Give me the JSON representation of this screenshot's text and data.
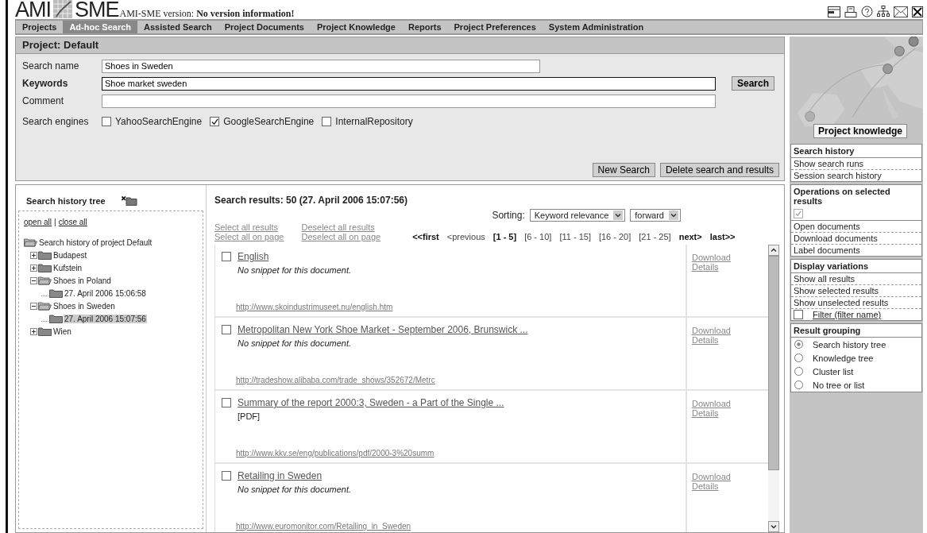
{
  "header": {
    "logo_left": "AMI",
    "logo_right": "SME",
    "version": "AMI-SME version: **No version information!**"
  },
  "nav": [
    {
      "label": "Projects",
      "selected": false
    },
    {
      "label": "Ad-hoc Search",
      "selected": true
    },
    {
      "label": "Assisted Search",
      "selected": false
    },
    {
      "label": "Project Documents",
      "selected": false
    },
    {
      "label": "Project Knowledge",
      "selected": false
    },
    {
      "label": "Reports",
      "selected": false
    },
    {
      "label": "Project Preferences",
      "selected": false
    },
    {
      "label": "System Administration",
      "selected": false
    }
  ],
  "project": {
    "title": "Project: Default",
    "fields": [
      {
        "label": "Search name",
        "value": "Shoes in Sweden",
        "focused": false,
        "wide": false
      },
      {
        "label": "Keywords",
        "value": "Shoe market sweden",
        "focused": true,
        "wide": true,
        "button": "Search"
      },
      {
        "label": "Comment",
        "focused": false,
        "wide": true
      }
    ],
    "engines_label": "Search engines",
    "engines": [
      {
        "label": "YahooSearchEngine",
        "checked": false
      },
      {
        "label": "GoogleSearchEngine",
        "checked": true
      },
      {
        "label": "InternalRepository",
        "checked": false
      }
    ],
    "buttons": [
      "New Search",
      "Delete search and results"
    ]
  },
  "tree": {
    "title": "Search history tree",
    "open_all": "open all",
    "separator": "|",
    "close_all": "close all",
    "nodes": [
      {
        "label": "Search history of project Default",
        "selected": false,
        "children": [
          {
            "label": "Budapest",
            "expanded": false,
            "selected": false
          },
          {
            "label": "Kufstein",
            "expanded": false,
            "selected": false
          },
          {
            "label": "Shoes in Poland",
            "expanded": true,
            "selected": false,
            "children": [
              {
                "label": "27. April 2006 15:06:58",
                "selected": false
              }
            ]
          },
          {
            "label": "Shoes in Sweden",
            "expanded": true,
            "selected": false,
            "children": [
              {
                "label": "27. April 2006 15:07:56",
                "selected": true
              }
            ]
          },
          {
            "label": "Wien",
            "expanded": false,
            "selected": false
          }
        ]
      }
    ]
  },
  "results": {
    "heading": "Search results: 50 (27. April 2006 15:07:56)",
    "sorting_label": "Sorting:",
    "sort_by": "Keyword relevance",
    "sort_dir": "forward",
    "select_links": [
      [
        "Select all results",
        "Select all on page"
      ],
      [
        "Deselect all results",
        "Deselect all on page"
      ]
    ],
    "pager": [
      {
        "label": "<<first",
        "kind": "nav",
        "disabled": false
      },
      {
        "label": "<previous",
        "kind": "nav",
        "disabled": true
      },
      {
        "label": "[1 - 5]",
        "kind": "page",
        "selected": true
      },
      {
        "label": "[6 - 10]",
        "kind": "page",
        "selected": false
      },
      {
        "label": "[11 - 15]",
        "kind": "page",
        "selected": false
      },
      {
        "label": "[16 - 20]",
        "kind": "page",
        "selected": false
      },
      {
        "label": "[21 - 25]",
        "kind": "page",
        "selected": false
      },
      {
        "label": "next>",
        "kind": "nav",
        "disabled": false
      },
      {
        "label": "last>>",
        "kind": "nav",
        "disabled": false
      }
    ],
    "items": [
      {
        "title": "English",
        "snippet": "No snippet for this document.",
        "italic": true,
        "url": "http://www.skoindustrimuseet.nu/english.htm",
        "checked": false,
        "actions": [
          "Download",
          "Details"
        ]
      },
      {
        "title": "Metropolitan New York Shoe Market - September 2006, Brunswick ...",
        "snippet": "No snippet for this document.",
        "italic": true,
        "url": "http://tradeshow.alibaba.com/trade_shows/352672/Metrc",
        "checked": false,
        "actions": [
          "Download",
          "Details"
        ]
      },
      {
        "title": "Summary of the report 2000:3, Sweden - a Part of the Single ...",
        "snippet": "[PDF]",
        "italic": false,
        "url": "http://www.kkv.se/eng/publications/pdf/2000-3%20summ",
        "checked": false,
        "actions": [
          "Download",
          "Details"
        ]
      },
      {
        "title": "Retailing in Sweden",
        "snippet": "No snippet for this document.",
        "italic": true,
        "url": "http://www.euromonitor.com/Retailing_in_Sweden",
        "checked": false,
        "actions": [
          "Download",
          "Details"
        ]
      }
    ]
  },
  "sidebar": {
    "knowledge_button": "Project knowledge",
    "sections": [
      {
        "title": "Search history",
        "kind": "links",
        "items": [
          {
            "label": "Show search runs"
          },
          {
            "label": "Session search history"
          }
        ]
      },
      {
        "title": "Operations on selected results",
        "kind": "links",
        "checked": true,
        "items": [
          {
            "label": "Open documents"
          },
          {
            "label": "Download documents"
          },
          {
            "label": "Label documents"
          }
        ]
      },
      {
        "title": "Display variations",
        "kind": "links",
        "items": [
          {
            "label": "Show all results"
          },
          {
            "label": "Show selected results"
          },
          {
            "label": "Show unselected results"
          }
        ],
        "filter": {
          "label": "Filter (filter name)",
          "checked": false
        }
      },
      {
        "title": "Result grouping",
        "kind": "radios",
        "items": [
          {
            "label": "Search history tree",
            "selected": true
          },
          {
            "label": "Knowledge tree",
            "selected": false
          },
          {
            "label": "Cluster list",
            "selected": false
          },
          {
            "label": "No tree or list",
            "selected": false
          }
        ]
      }
    ]
  }
}
